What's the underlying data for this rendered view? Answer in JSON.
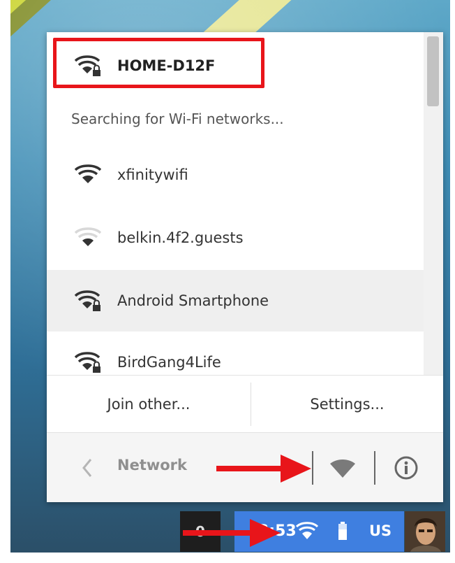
{
  "network_popup": {
    "connected_network": "HOME-D12F",
    "status_text": "Searching for Wi-Fi networks...",
    "networks": [
      {
        "name": "xfinitywifi",
        "signal": "full",
        "secured": false
      },
      {
        "name": "belkin.4f2.guests",
        "signal": "weak",
        "secured": false
      },
      {
        "name": "Android Smartphone",
        "signal": "full",
        "secured": true
      },
      {
        "name": "BirdGang4Life",
        "signal": "full",
        "secured": true
      }
    ],
    "join_other_label": "Join other...",
    "settings_label": "Settings...",
    "footer_title": "Network"
  },
  "shelf": {
    "counter": "0",
    "time": "3:53",
    "language": "US"
  },
  "icons": {
    "wifi_secured": "wifi-lock-icon",
    "wifi": "wifi-icon",
    "back": "chevron-left-icon",
    "info": "info-icon",
    "battery": "battery-icon"
  },
  "colors": {
    "highlight": "#e8151a",
    "tray_blue": "#3f7fe0",
    "active_row": "#efefef"
  }
}
